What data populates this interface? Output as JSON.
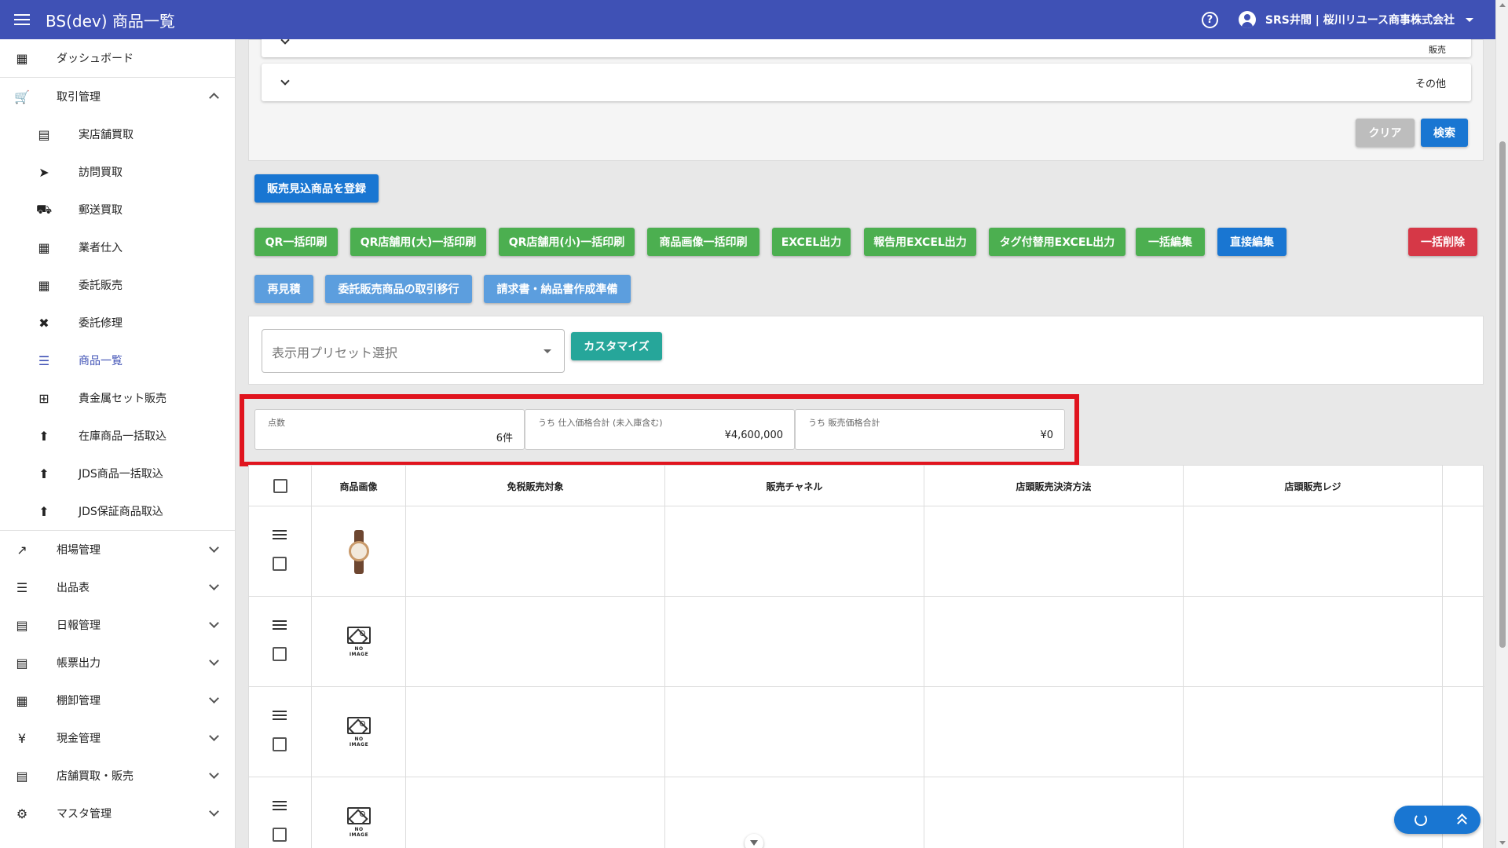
{
  "appbar": {
    "title": "BS(dev) 商品一覧",
    "user": "SRS井間 | 桜川リユース商事株式会社"
  },
  "sidebar": {
    "dashboard": "ダッシュボード",
    "trade_group": "取引管理",
    "sub_items": [
      {
        "label": "実店舗買取",
        "icon": "store-icon"
      },
      {
        "label": "訪問買取",
        "icon": "walk-icon"
      },
      {
        "label": "郵送買取",
        "icon": "truck-icon"
      },
      {
        "label": "業者仕入",
        "icon": "building-icon"
      },
      {
        "label": "委託販売",
        "icon": "consign-icon"
      },
      {
        "label": "委託修理",
        "icon": "tools-icon"
      },
      {
        "label": "商品一覧",
        "icon": "list-icon"
      },
      {
        "label": "貴金属セット販売",
        "icon": "grid-icon"
      },
      {
        "label": "在庫商品一括取込",
        "icon": "upload-icon"
      },
      {
        "label": "JDS商品一括取込",
        "icon": "upload-icon"
      },
      {
        "label": "JDS保証商品取込",
        "icon": "upload-icon"
      }
    ],
    "groups": [
      {
        "label": "相場管理",
        "icon": "trending-icon"
      },
      {
        "label": "出品表",
        "icon": "listing-icon"
      },
      {
        "label": "日報管理",
        "icon": "document-icon"
      },
      {
        "label": "帳票出力",
        "icon": "note-icon"
      },
      {
        "label": "棚卸管理",
        "icon": "archive-icon"
      },
      {
        "label": "現金管理",
        "icon": "yen-icon"
      },
      {
        "label": "店舗買取・販売",
        "icon": "store-icon"
      },
      {
        "label": "マスタ管理",
        "icon": "gear-icon"
      }
    ]
  },
  "search": {
    "partial_label": "販売",
    "other_label": "その他",
    "clear": "クリア",
    "search": "検索"
  },
  "actions": {
    "register": "販売見込商品を登録",
    "qr_bulk": "QR一括印刷",
    "qr_large": "QR店舗用(大)一括印刷",
    "qr_small": "QR店舗用(小)一括印刷",
    "image_print": "商品画像一括印刷",
    "excel": "EXCEL出力",
    "report_excel": "報告用EXCEL出力",
    "tag_excel": "タグ付替用EXCEL出力",
    "bulk_edit": "一括編集",
    "direct_edit": "直接編集",
    "bulk_delete": "一括削除",
    "re_estimate": "再見積",
    "consign_move": "委託販売商品の取引移行",
    "invoice_prep": "請求書・納品書作成準備"
  },
  "preset": {
    "placeholder": "表示用プリセット選択",
    "customize": "カスタマイズ"
  },
  "stats": [
    {
      "label": "点数",
      "value": "6件"
    },
    {
      "label": "うち 仕入価格合計 (未入庫含む)",
      "value": "¥4,600,000"
    },
    {
      "label": "うち 販売価格合計",
      "value": "¥0"
    }
  ],
  "table": {
    "headers": [
      "商品画像",
      "免税販売対象",
      "販売チャネル",
      "店頭販売決済方法",
      "店頭販売レジ"
    ],
    "no_image": "NO IMAGE"
  }
}
